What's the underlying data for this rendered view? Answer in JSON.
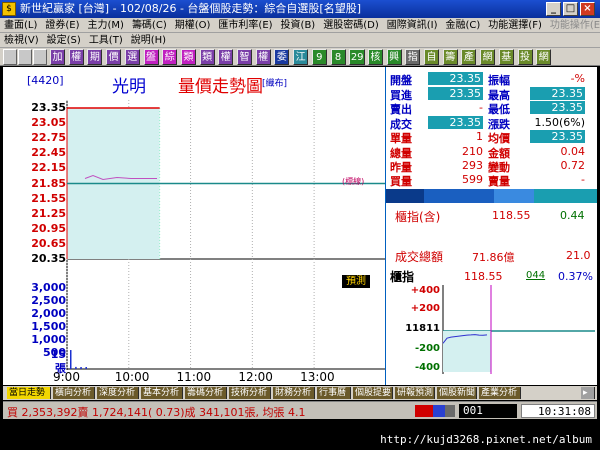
{
  "window": {
    "title": "新世紀贏家 [台灣] - 102/08/26 - 台盤個股走勢：綜合自選股[名望股]",
    "app_icon": "$"
  },
  "menu1": [
    "畫面(L)",
    "證券(E)",
    "主力(M)",
    "籌碼(C)",
    "期權(O)",
    "匯市利率(E)",
    "投資(B)",
    "選股密碼(D)",
    "國際資訊(I)",
    "金融(C)",
    "功能選擇(F)"
  ],
  "menu1_dim": [
    "功能操作(E)"
  ],
  "menu2": [
    "檢視(V)",
    "設定(S)",
    "工具(T)",
    "說明(H)"
  ],
  "toolbar": [
    {
      "t": "加",
      "c": "#7a3ea8"
    },
    {
      "t": "權",
      "c": "#7a3ea8"
    },
    {
      "t": "期",
      "c": "#7a3ea8"
    },
    {
      "t": "價",
      "c": "#7a3ea8"
    },
    {
      "t": "選",
      "c": "#7a3ea8"
    },
    {
      "t": "盤",
      "c": "#c020c0"
    },
    {
      "t": "綜",
      "c": "#c020c0"
    },
    {
      "t": "類",
      "c": "#c020c0"
    },
    {
      "t": "類",
      "c": "#7a3ea8"
    },
    {
      "t": "權",
      "c": "#7a3ea8"
    },
    {
      "t": "智",
      "c": "#7a3ea8"
    },
    {
      "t": "權",
      "c": "#7a3ea8"
    },
    {
      "t": "委",
      "c": "#1a3aa0"
    },
    {
      "t": "江",
      "c": "#2a8a9a"
    },
    {
      "t": "9",
      "c": "#2a8a2a"
    },
    {
      "t": "8",
      "c": "#2a8a2a"
    },
    {
      "t": "29",
      "c": "#2a8a2a"
    },
    {
      "t": "核",
      "c": "#2a8a2a"
    },
    {
      "t": "興",
      "c": "#2a8a2a"
    },
    {
      "t": "指",
      "c": "#6a6a6a"
    },
    {
      "t": "自",
      "c": "#6a8a2a"
    },
    {
      "t": "籌",
      "c": "#6a8a2a"
    },
    {
      "t": "產",
      "c": "#6a8a2a"
    },
    {
      "t": "網",
      "c": "#6a8a2a"
    },
    {
      "t": "基",
      "c": "#6a8a2a"
    },
    {
      "t": "投",
      "c": "#6a8a2a"
    },
    {
      "t": "網",
      "c": "#6a8a2a"
    }
  ],
  "stock": {
    "code": "[4420]",
    "name": "光明",
    "chart_title": "量價走勢圖",
    "tag": "[織布]"
  },
  "price_labels": [
    {
      "v": "23.35",
      "c": "#000000"
    },
    {
      "v": "23.05",
      "c": "#d00000"
    },
    {
      "v": "22.75",
      "c": "#d00000"
    },
    {
      "v": "22.45",
      "c": "#d00000"
    },
    {
      "v": "22.15",
      "c": "#d00000"
    },
    {
      "v": "21.85",
      "c": "#d00000"
    },
    {
      "v": "21.55",
      "c": "#d00000"
    },
    {
      "v": "21.25",
      "c": "#d00000"
    },
    {
      "v": "20.95",
      "c": "#d00000"
    },
    {
      "v": "20.65",
      "c": "#d00000"
    },
    {
      "v": "20.35",
      "c": "#000000"
    }
  ],
  "volume_labels": [
    "3,000",
    "2,500",
    "2,000",
    "1,500",
    "1,000",
    "500",
    "15",
    "張"
  ],
  "time_labels": [
    "9:00",
    "10:00",
    "11:00",
    "12:00",
    "13:00"
  ],
  "annotation": "(標線)",
  "yuce": "預測",
  "quote": {
    "open_lbl": "開盤",
    "open": "23.35",
    "amp_lbl": "振幅",
    "amp": "-%",
    "buy_lbl": "買進",
    "buy": "23.35",
    "high_lbl": "最高",
    "high": "23.35",
    "sell_lbl": "賣出",
    "sell": "-",
    "low_lbl": "最低",
    "low": "23.35",
    "deal_lbl": "成交",
    "deal": "23.35",
    "chg_lbl": "漲跌",
    "chg": "1.50(6%)",
    "unit_lbl": "單量",
    "unit": "1",
    "avg_lbl": "均價",
    "avg": "23.35",
    "tvol_lbl": "總量",
    "tvol": "210",
    "amt_lbl": "金額",
    "amt": "0.04",
    "yvol_lbl": "昨量",
    "yvol": "293",
    "vchg_lbl": "變動",
    "vchg": "0.72",
    "bvol_lbl": "買量",
    "bvol": "599",
    "svol_lbl": "賣量",
    "svol": "-"
  },
  "index": {
    "title": "櫃指(含)",
    "value": "118.55",
    "change": "0.44",
    "total_lbl": "成交總額",
    "total": "71.86億",
    "total_chg": "21.0"
  },
  "mini": {
    "title": "櫃指",
    "value": "118.55",
    "vol": "044",
    "pct": "0.37%",
    "labels": [
      {
        "v": "+400",
        "c": "#d00000"
      },
      {
        "v": "+200",
        "c": "#d00000"
      },
      {
        "v": "11811",
        "c": "#000000"
      },
      {
        "v": "-200",
        "c": "#007000"
      },
      {
        "v": "-400",
        "c": "#007000"
      }
    ]
  },
  "tabs": [
    "當日走勢",
    "橫向分析",
    "深度分析",
    "基本分析",
    "籌碼分析",
    "技術分析",
    "財務分析",
    "行事曆",
    "個股提要",
    "研報預測",
    "個股新聞",
    "產業分析"
  ],
  "status": {
    "text": "買 2,353,392賣 1,724,141( 0.73)成 341,101張, 均張 4.1",
    "code": "001",
    "time": "10:31:08"
  },
  "url": "http://kujd3268.pixnet.net/album",
  "colors": {
    "accent": "#1a9eb0",
    "up": "#d00000",
    "down": "#007000"
  },
  "chart_data": {
    "type": "line",
    "title": "量價走勢圖",
    "x_range": [
      "9:00",
      "13:30"
    ],
    "ylim": [
      20.35,
      23.35
    ],
    "reference_price": 21.85,
    "series": [
      {
        "x": [
          "9:00",
          "9:05",
          "9:10",
          "9:15",
          "9:20",
          "9:25",
          "9:30",
          "9:35",
          "9:40",
          "9:45",
          "9:50",
          "9:55",
          "10:00",
          "10:05",
          "10:10",
          "10:15",
          "10:20",
          "10:30"
        ],
        "values": [
          23.35,
          23.35,
          23.35,
          23.35,
          23.35,
          23.35,
          23.35,
          23.35,
          23.35,
          23.35,
          23.35,
          23.35,
          23.35,
          23.35,
          23.35,
          23.35,
          23.35,
          23.35
        ]
      }
    ],
    "volume": {
      "x": [
        "9:00",
        "9:05",
        "9:10",
        "9:15"
      ],
      "values": [
        180,
        20,
        10,
        12
      ],
      "ylim": [
        0,
        3000
      ]
    },
    "index_mini": {
      "x_range": [
        "9:00",
        "10:30"
      ],
      "reference": 118.11,
      "ylim": [
        -400,
        400
      ],
      "values": [
        -120,
        -70,
        -60,
        -55,
        -50,
        -45,
        -40,
        -38,
        -35,
        -40,
        -42,
        -38
      ]
    }
  }
}
